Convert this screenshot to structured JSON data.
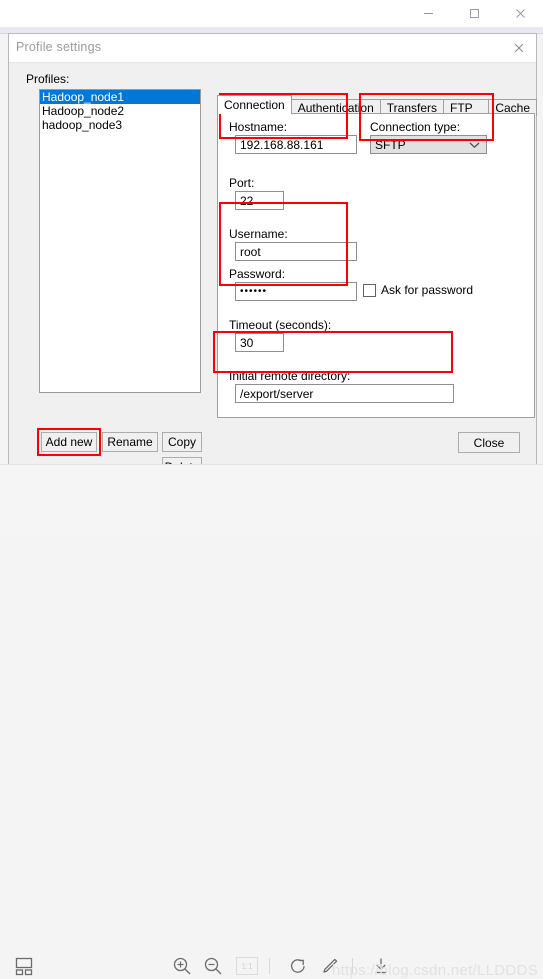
{
  "viewer": {
    "window_buttons": [
      {
        "name": "minimize",
        "glyph": "─"
      },
      {
        "name": "maximize",
        "glyph": "❐"
      },
      {
        "name": "close",
        "glyph": "✕"
      }
    ]
  },
  "dialog": {
    "title": "Profile settings",
    "close_glyph": "✕"
  },
  "profiles": {
    "label": "Profiles:",
    "items": [
      {
        "name": "Hadoop_node1",
        "selected": true
      },
      {
        "name": "Hadoop_node2",
        "selected": false
      },
      {
        "name": "hadoop_node3",
        "selected": false
      }
    ],
    "buttons": {
      "add_new": "Add new",
      "rename": "Rename",
      "copy": "Copy",
      "delete": "Delete"
    }
  },
  "tabs": [
    {
      "label": "Connection",
      "active": true
    },
    {
      "label": "Authentication",
      "active": false
    },
    {
      "label": "Transfers",
      "active": false
    },
    {
      "label": "FTP Misc.",
      "active": false
    },
    {
      "label": "Cache",
      "active": false
    }
  ],
  "connection": {
    "hostname": {
      "label": "Hostname:",
      "value": "192.168.88.161"
    },
    "connection_type": {
      "label": "Connection type:",
      "value": "SFTP",
      "caret": "⌄"
    },
    "port": {
      "label": "Port:",
      "value": "22"
    },
    "username": {
      "label": "Username:",
      "value": "root"
    },
    "password": {
      "label": "Password:",
      "value": "••••••"
    },
    "ask_for_password": {
      "label": "Ask for password",
      "checked": false
    },
    "timeout": {
      "label": "Timeout (seconds):",
      "value": "30"
    },
    "initial_remote_directory": {
      "label": "Initial remote directory:",
      "value": "/export/server"
    }
  },
  "footer": {
    "close": "Close"
  },
  "toolbar": {
    "one_to_one_label": "1:1",
    "watermark": "https://blog.csdn.net/LLDDDS"
  },
  "highlights": {
    "color": "#ff0000",
    "regions": [
      "hostname",
      "connection-type",
      "credentials",
      "initial-remote-directory",
      "add-new-button"
    ]
  }
}
